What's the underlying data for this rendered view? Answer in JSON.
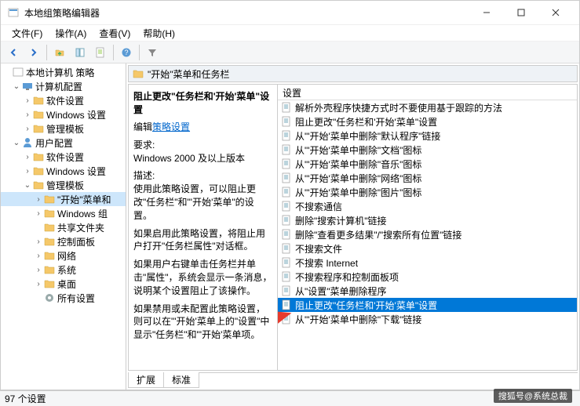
{
  "window": {
    "title": "本地组策略编辑器"
  },
  "menu": {
    "file": "文件(F)",
    "action": "操作(A)",
    "view": "查看(V)",
    "help": "帮助(H)"
  },
  "tree": {
    "root": "本地计算机 策略",
    "comp_cfg": "计算机配置",
    "sw1": "软件设置",
    "win1": "Windows 设置",
    "admin1": "管理模板",
    "user_cfg": "用户配置",
    "sw2": "软件设置",
    "win2": "Windows 设置",
    "admin2": "管理模板",
    "start": "\"开始\"菜单和",
    "wincomp": "Windows 组",
    "shared": "共享文件夹",
    "ctrlpanel": "控制面板",
    "network": "网络",
    "system": "系统",
    "desktop": "桌面",
    "allsettings": "所有设置"
  },
  "path": "\"开始\"菜单和任务栏",
  "desc": {
    "title": "阻止更改\"任务栏和'开始'菜单\"设置",
    "edit": "编辑",
    "editlink": "策略设置",
    "req_label": "要求:",
    "req": "Windows 2000 及以上版本",
    "desc_label": "描述:",
    "p1": "使用此策略设置，可以阻止更改\"任务栏\"和\"'开始'菜单\"的设置。",
    "p2": "如果启用此策略设置，将阻止用户打开\"任务栏属性\"对话框。",
    "p3": "如果用户右键单击任务栏并单击\"属性\"，系统会显示一条消息，说明某个设置阻止了该操作。",
    "p4": "如果禁用或未配置此策略设置，则可以在\"'开始'菜单上的\"设置\"中显示\"任务栏\"和\"'开始'菜单项。"
  },
  "list": {
    "header": "设置",
    "items": [
      "解析外壳程序快捷方式时不要使用基于跟踪的方法",
      "阻止更改\"任务栏和'开始'菜单\"设置",
      "从\"'开始'菜单中删除\"默认程序\"链接",
      "从\"'开始'菜单中删除\"文档\"图标",
      "从\"'开始'菜单中删除\"音乐\"图标",
      "从\"'开始'菜单中删除\"网络\"图标",
      "从\"'开始'菜单中删除\"图片\"图标",
      "不搜索通信",
      "删除\"搜索计算机\"链接",
      "删除\"查看更多结果\"/\"搜索所有位置\"链接",
      "不搜索文件",
      "不搜索 Internet",
      "不搜索程序和控制面板项",
      "从\"设置\"菜单删除程序",
      "阻止更改\"任务栏和'开始'菜单\"设置",
      "从\"'开始'菜单中删除\"下载\"链接"
    ],
    "selected_index": 14
  },
  "tabs": {
    "ext": "扩展",
    "std": "标准"
  },
  "status": "97 个设置",
  "watermark": "搜狐号@系统总裁"
}
